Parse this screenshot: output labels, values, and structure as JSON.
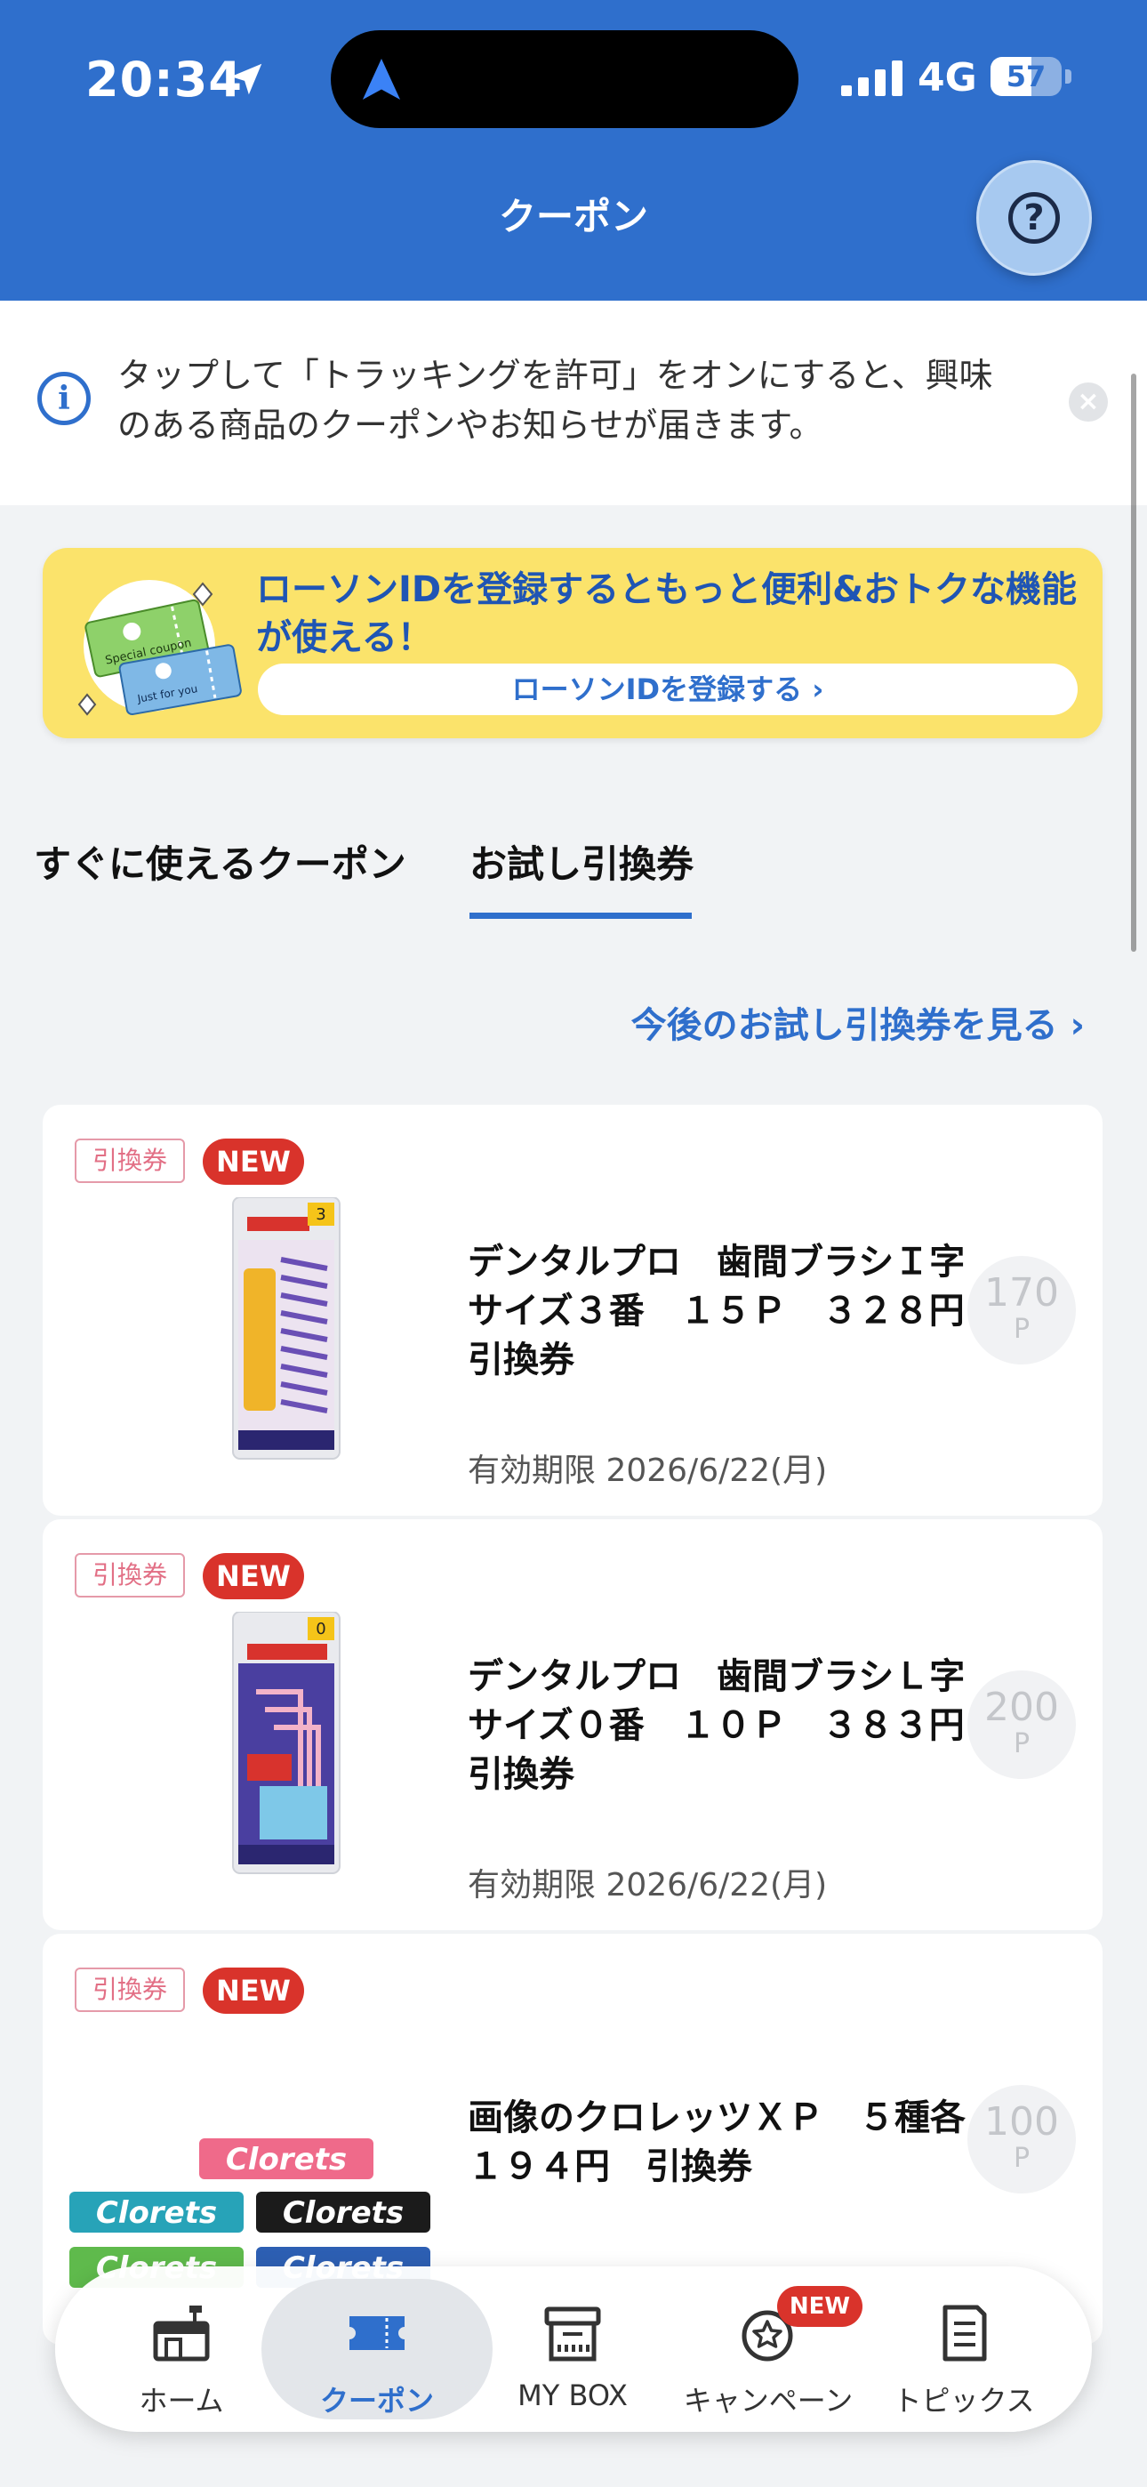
{
  "status_bar": {
    "time": "20:34",
    "network": "4G",
    "battery": "57",
    "battery_level": 0.57
  },
  "header": {
    "title": "クーポン",
    "help_label": "?"
  },
  "info_banner": {
    "text": "タップして「トラッキングを許可」をオンにすると、興味のある商品のクーポンやお知らせが届きます。"
  },
  "promo_banner": {
    "title": "ローソンIDを登録するともっと便利&おトクな機能が使える！",
    "button_label": "ローソンIDを登録する ›",
    "ticket1_text": "Special coupon",
    "ticket2_text": "Just for you"
  },
  "tabs": [
    {
      "label": "すぐに使えるクーポン",
      "active": false
    },
    {
      "label": "お試し引換券",
      "active": true
    }
  ],
  "future_link": "今後のお試し引換券を見る ›",
  "coupons": [
    {
      "type": "引換券",
      "badge": "NEW",
      "name": "デンタルプロ　歯間ブラシＩ字サイズ３番　１５Ｐ　３２８円　引換券",
      "expiry": "有効期限 2026/6/22(月)",
      "points": "170",
      "unit": "P"
    },
    {
      "type": "引換券",
      "badge": "NEW",
      "name": "デンタルプロ　歯間ブラシＬ字サイズ０番　１０Ｐ　３８３円　引換券",
      "expiry": "有効期限 2026/6/22(月)",
      "points": "200",
      "unit": "P"
    },
    {
      "type": "引換券",
      "badge": "NEW",
      "name": "画像のクロレッツＸＰ　５種各１９４円　引換券",
      "expiry": "",
      "points": "100",
      "unit": "P"
    }
  ],
  "product_labels": {
    "clorets": "Clorets",
    "sample1": "3",
    "sample2": "0"
  },
  "bottom_nav": {
    "items": [
      {
        "label": "ホーム",
        "icon": "home-icon"
      },
      {
        "label": "クーポン",
        "icon": "coupon-icon",
        "active": true
      },
      {
        "label": "MY BOX",
        "icon": "box-icon"
      },
      {
        "label": "キャンペーン",
        "icon": "campaign-icon"
      },
      {
        "label": "トピックス",
        "icon": "topics-icon"
      }
    ],
    "campaign_badge": "NEW"
  },
  "colors": {
    "brand_blue": "#2f6fcc",
    "banner_yellow": "#fbe36b",
    "new_red": "#d9332b"
  }
}
